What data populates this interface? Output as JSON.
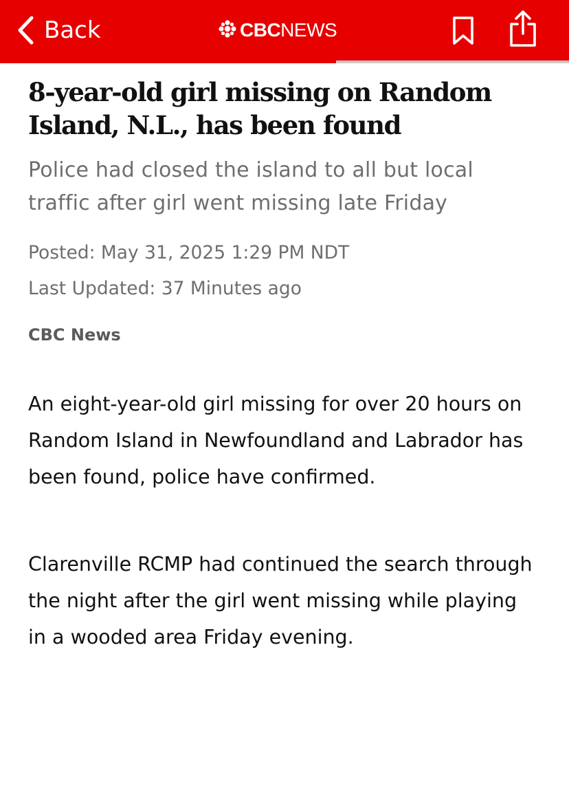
{
  "header": {
    "back_label": "Back",
    "brand_bold": "CBC",
    "brand_light": "NEWS",
    "back_icon": "chevron-left-icon",
    "brand_icon": "cbc-gem-logo",
    "bookmark_icon": "bookmark-icon",
    "share_icon": "share-icon",
    "bar_color": "#e60000",
    "reading_progress_percent": 59
  },
  "article": {
    "headline": "8-year-old girl missing on Random Island, N.L., has been found",
    "deck": "Police had closed the island to all but local traffic after girl went missing late Friday",
    "posted": "Posted: May 31, 2025 1:29 PM NDT",
    "updated": "Last Updated: 37 Minutes ago",
    "byline": "CBC News",
    "paragraphs": [
      "An eight-year-old girl missing for over 20 hours on Random Island in Newfoundland and Labrador has been found, police have confirmed.",
      "Clarenville RCMP had continued the search through the night after the girl went missing while playing in a wooded area Friday evening."
    ]
  }
}
